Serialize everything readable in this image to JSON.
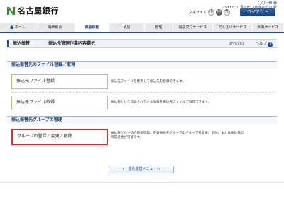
{
  "header": {
    "bank_name": "名古屋銀行",
    "user_line": "〇〇一郎 様",
    "login_time": "20XX年01月20日 10時00分00秒",
    "font_size_label": "文字サイズ",
    "font_small": "小",
    "font_medium": "中",
    "font_large": "大",
    "logout_label": "ログアウト"
  },
  "nav": {
    "items": [
      {
        "label": "ホーム",
        "active": false
      },
      {
        "label": "明細照会",
        "active": false
      },
      {
        "label": "資金移動",
        "active": true
      },
      {
        "label": "承認",
        "active": false
      },
      {
        "label": "管理",
        "active": false
      },
      {
        "label": "電子交付サービス",
        "active": false
      },
      {
        "label": "でんさいサービス",
        "active": false
      },
      {
        "label": "外為サービス",
        "active": false
      }
    ]
  },
  "page": {
    "category": "振込振替",
    "title": "振込先管理作業内容選択",
    "code": "BFFK001",
    "help_label": "ヘルプ",
    "help_icon": "question-icon"
  },
  "section1": {
    "heading": "振込振替先のファイル登録／取得",
    "items": [
      {
        "label": "振込先ファイル登録",
        "desc": "振込先ファイルを使用して振込先を登録できます。"
      },
      {
        "label": "振込先ファイル取得",
        "desc": "振込先として登録されている情報を振込先ファイルで取得できます。"
      }
    ]
  },
  "section2": {
    "heading": "振込振替先グループの管理",
    "items": [
      {
        "label": "グループの登録／変更／削除",
        "desc1": "振込先グループの新規登録、登録振込先グループのグループ名変更、削除、または振込先の",
        "desc2": "所属変更が可能です。"
      }
    ]
  },
  "back_button": {
    "label": "振込振替メニューへ"
  }
}
